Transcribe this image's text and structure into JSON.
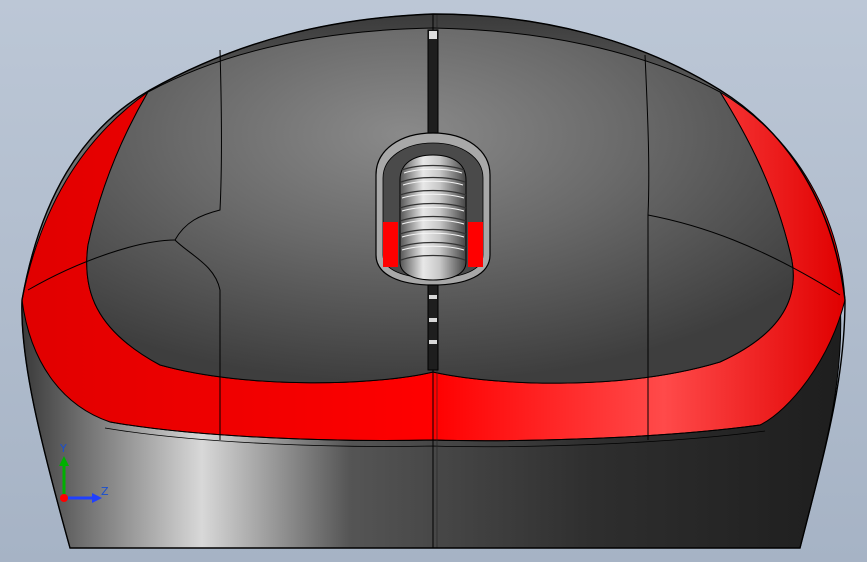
{
  "colors": {
    "background_top": "#bcc7d6",
    "background_bottom": "#a4b1c3",
    "body_dark": "#2c2c2c",
    "body_mid": "#6a6a6a",
    "accent_red": "#ff0000",
    "axis_x": "#ff0000",
    "axis_y": "#00b000",
    "axis_z": "#2040ff",
    "axis_label": "#1a4fd0"
  },
  "triad": {
    "y_label": "Y",
    "z_label": "Z",
    "icon": "coordinate-triad-icon"
  }
}
